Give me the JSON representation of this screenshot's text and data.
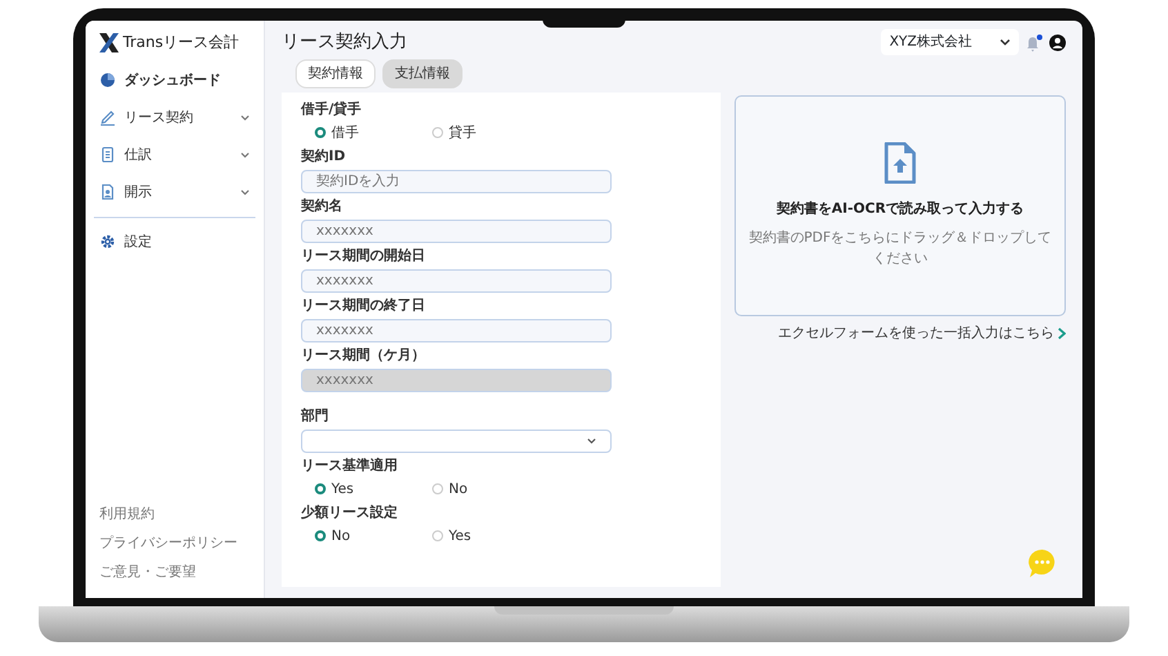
{
  "sidebar": {
    "logo": {
      "brand": "Transリース会計"
    },
    "items": [
      {
        "label": "ダッシュボード",
        "kind": "link",
        "selected": true
      },
      {
        "label": "リース契約",
        "kind": "menu",
        "selected": false
      },
      {
        "label": "仕訳",
        "kind": "menu",
        "selected": false
      },
      {
        "label": "開示",
        "kind": "menu",
        "selected": false
      }
    ],
    "settings": {
      "label": "設定",
      "selected": false
    },
    "footer_links": [
      "利用規約",
      "プライバシーポリシー",
      "ご意見・ご要望"
    ]
  },
  "header": {
    "title": "リース契約入力",
    "company": "XYZ株式会社",
    "notifications": {
      "unread": true
    }
  },
  "tabs": [
    {
      "label": "契約情報",
      "selected": false
    },
    {
      "label": "支払情報",
      "selected": true
    }
  ],
  "form": [
    {
      "kind": "radio",
      "label": "借手/貸手",
      "options": [
        {
          "label": "借手",
          "selected": true
        },
        {
          "label": "貸手",
          "selected": false
        }
      ]
    },
    {
      "kind": "text",
      "label": "契約ID",
      "placeholder": "契約IDを入力",
      "disabled": false
    },
    {
      "kind": "text",
      "label": "契約名",
      "placeholder": "xxxxxxx",
      "disabled": false
    },
    {
      "kind": "text",
      "label": "リース期間の開始日",
      "placeholder": "xxxxxxx",
      "disabled": false
    },
    {
      "kind": "text",
      "label": "リース期間の終了日",
      "placeholder": "xxxxxxx",
      "disabled": false
    },
    {
      "kind": "text",
      "label": "リース期間（ケ月）",
      "placeholder": "xxxxxxx",
      "disabled": true
    },
    {
      "kind": "select",
      "label": "部門"
    },
    {
      "kind": "radio",
      "label": "リース基準適用",
      "options": [
        {
          "label": "Yes",
          "selected": true
        },
        {
          "label": "No",
          "selected": false
        }
      ]
    },
    {
      "kind": "radio",
      "label": "少額リース設定",
      "options": [
        {
          "label": "No",
          "selected": true
        },
        {
          "label": "Yes",
          "selected": false
        }
      ]
    }
  ],
  "upload": {
    "title": "契約書をAI-OCRで読み取って入力する",
    "description": "契約書のPDFをこちらにドラッグ＆ドロップしてください"
  },
  "excel_link": "エクセルフォームを使った一括入力はこちら"
}
